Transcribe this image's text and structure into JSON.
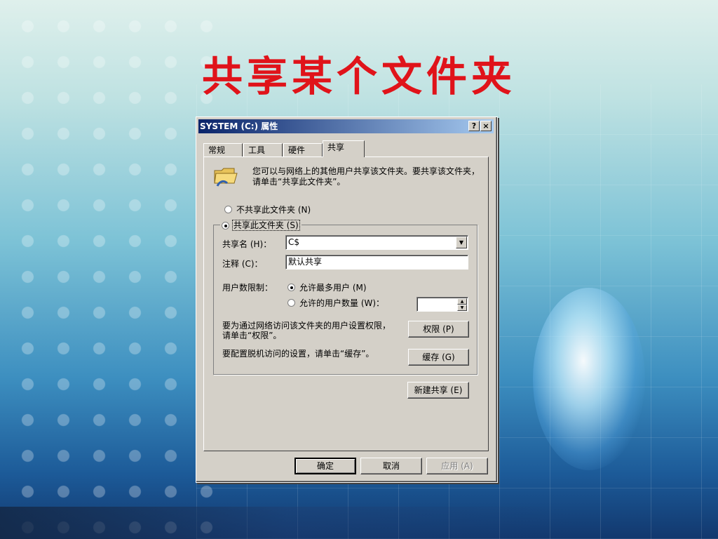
{
  "slide": {
    "title": "共享某个文件夹"
  },
  "dialog": {
    "title": "SYSTEM (C:) 属性",
    "help_button": "?",
    "close_button": "×",
    "tabs": [
      {
        "label": "常规",
        "active": false
      },
      {
        "label": "工具",
        "active": false
      },
      {
        "label": "硬件",
        "active": false
      },
      {
        "label": "共享",
        "active": true
      }
    ],
    "intro_text": "您可以与网络上的其他用户共享该文件夹。要共享该文件夹，请单击“共享此文件夹”。",
    "icon": "folder-share-icon",
    "radio_not_share": {
      "label": "不共享此文件夹 (N)",
      "checked": false
    },
    "radio_share": {
      "label": "共享此文件夹 (S)",
      "checked": true
    },
    "share_name": {
      "label": "共享名 (H)：",
      "value": "C$"
    },
    "comment": {
      "label": "注释 (C)：",
      "value": "默认共享"
    },
    "user_limit": {
      "label": "用户数限制：",
      "max_allowed": {
        "label": "允许最多用户 (M)",
        "checked": true
      },
      "allow_count": {
        "label": "允许的用户数量 (W)：",
        "checked": false,
        "value": ""
      }
    },
    "permissions": {
      "text": "要为通过网络访问该文件夹的用户设置权限，请单击“权限”。",
      "button": "权限 (P)"
    },
    "caching": {
      "text": "要配置脱机访问的设置，请单击“缓存”。",
      "button": "缓存 (G)"
    },
    "new_share_button": "新建共享 (E)",
    "ok_button": "确定",
    "cancel_button": "取消",
    "apply_button": "应用 (A)"
  }
}
